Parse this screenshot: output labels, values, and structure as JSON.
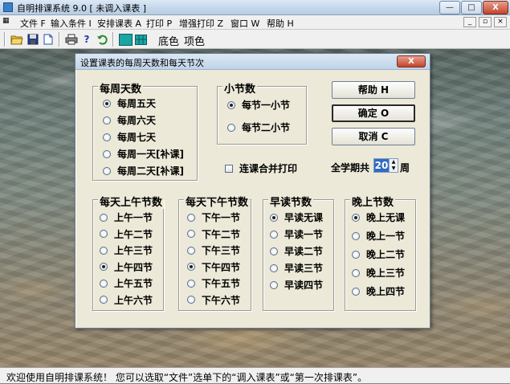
{
  "window": {
    "title": "自明排课系统 9.0 [ 未调入课表 ]",
    "minimize_glyph": "—",
    "maximize_glyph": "□",
    "close_glyph": "X"
  },
  "menu": {
    "items": [
      "文件 F",
      "输入条件 I",
      "安排课表 A",
      "打印 P",
      "增强打印 Z",
      "窗口 W",
      "帮助 H"
    ],
    "mdi_min_glyph": "_",
    "mdi_restore_glyph": "▫",
    "mdi_close_glyph": "×"
  },
  "toolbar": {
    "background_color_label": "底色",
    "items_label": "项色"
  },
  "status": {
    "text": "欢迎使用自明排课系统！ 您可以选取“文件”选单下的“调入课表”或“第一次排课表”。"
  },
  "dialog": {
    "title": "设置课表的每周天数和每天节次",
    "close_glyph": "X",
    "weekly_days": {
      "title": "每周天数",
      "options": [
        "每周五天",
        "每周六天",
        "每周七天",
        "每周一天[补课]",
        "每周二天[补课]"
      ],
      "selected_index": 0
    },
    "sub_period": {
      "title": "小节数",
      "options": [
        "每节一小节",
        "每节二小节"
      ],
      "selected_index": 0
    },
    "buttons": {
      "help": "帮助 H",
      "ok": "确定 O",
      "cancel": "取消 C"
    },
    "merge_print": {
      "label": "连课合并打印",
      "checked": false
    },
    "semester": {
      "label": "全学期共",
      "weeks": "20",
      "unit": "周"
    },
    "morning": {
      "title": "每天上午节数",
      "options": [
        "上午一节",
        "上午二节",
        "上午三节",
        "上午四节",
        "上午五节",
        "上午六节"
      ],
      "selected_index": 3
    },
    "afternoon": {
      "title": "每天下午节数",
      "options": [
        "下午一节",
        "下午二节",
        "下午三节",
        "下午四节",
        "下午五节",
        "下午六节"
      ],
      "selected_index": 3
    },
    "early": {
      "title": "早读节数",
      "options": [
        "早读无课",
        "早读一节",
        "早读二节",
        "早读三节",
        "早读四节"
      ],
      "selected_index": 0
    },
    "evening": {
      "title": "晚上节数",
      "options": [
        "晚上无课",
        "晚上一节",
        "晚上二节",
        "晚上三节",
        "晚上四节"
      ],
      "selected_index": 0
    }
  }
}
